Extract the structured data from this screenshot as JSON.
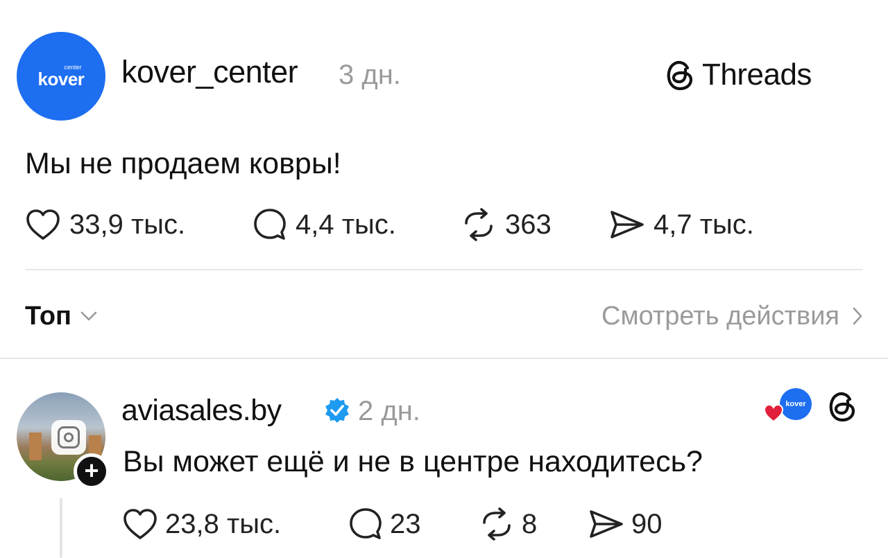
{
  "post": {
    "username": "kover_center",
    "time": "3 дн.",
    "text": "Мы не продаем ковры!",
    "avatar_logo_small": "center",
    "avatar_logo": "kover",
    "brand": "Threads",
    "stats": {
      "likes": "33,9 тыс.",
      "replies": "4,4 тыс.",
      "reposts": "363",
      "shares": "4,7 тыс."
    }
  },
  "sort": {
    "label": "Топ",
    "activity_label": "Смотреть действия"
  },
  "reply": {
    "username": "aviasales.by",
    "verified": true,
    "time": "2 дн.",
    "text": "Вы может ещё и не в центре находитесь?",
    "liked_by_logo": "kover",
    "follow_symbol": "+",
    "stats": {
      "likes": "23,8 тыс.",
      "replies": "23",
      "reposts": "8",
      "shares": "90"
    }
  },
  "icons": {
    "like": "heart-outline-icon",
    "reply": "speech-bubble-icon",
    "repost": "repost-arrows-icon",
    "share": "paper-plane-icon",
    "threads": "threads-logo-icon",
    "verified": "verified-badge-icon",
    "chevron_down": "chevron-down-icon",
    "chevron_right": "chevron-right-icon"
  },
  "colors": {
    "brand_blue": "#1d6ef0",
    "muted_text": "#9a9a9a",
    "verified_blue": "#1d9bf0",
    "heart_red": "#e0203c"
  }
}
